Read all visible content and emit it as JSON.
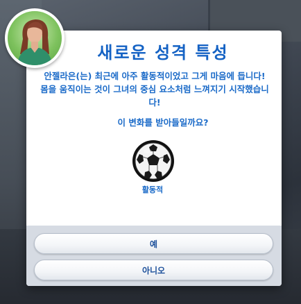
{
  "dialog": {
    "title": "새로운 성격 특성",
    "message": "안젤라은(는) 최근에 아주 활동적이었고 그게 마음에 듭니다! 몸을 움직이는 것이 그녀의 중심 요소처럼 느껴지기 시작했습니다!",
    "question": "이 변화를 받아들일까요?",
    "trait_icon": "soccer-ball-icon",
    "trait_label": "활동적",
    "yes_label": "예",
    "no_label": "아니오"
  },
  "colors": {
    "title": "#1462c4",
    "text": "#1a6ac8",
    "footer": "#d6dbe3",
    "avatar_bg": "#7ec25e"
  }
}
